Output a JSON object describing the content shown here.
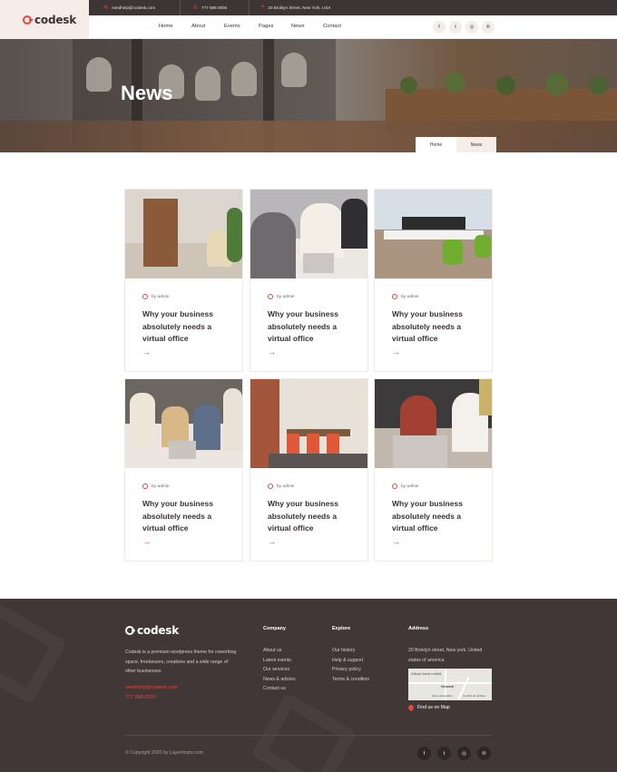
{
  "brand": {
    "name": "codesk"
  },
  "topbar": {
    "email": "needhelp@codesk.com",
    "phone": "777 888 0000",
    "address": "20 Broklyn Street, New York. USA"
  },
  "nav": {
    "items": [
      "Home",
      "About",
      "Events",
      "Pages",
      "News",
      "Contact"
    ]
  },
  "social_icons": [
    "facebook-icon",
    "twitter-icon",
    "instagram-icon",
    "pinterest-icon"
  ],
  "social_glyphs": [
    "f",
    "t",
    "◎",
    "℗"
  ],
  "hero": {
    "title": "News"
  },
  "breadcrumb": {
    "home": "Home",
    "current": "News"
  },
  "posts": [
    {
      "author": "by admin",
      "title": "Why your business absolutely needs a virtual office",
      "arrow": "→"
    },
    {
      "author": "by admin",
      "title": "Why your business absolutely needs a virtual office",
      "arrow": "→"
    },
    {
      "author": "by admin",
      "title": "Why your business absolutely needs a virtual office",
      "arrow": "→"
    },
    {
      "author": "by admin",
      "title": "Why your business absolutely needs a virtual office",
      "arrow": "→"
    },
    {
      "author": "by admin",
      "title": "Why your business absolutely needs a virtual office",
      "arrow": "→"
    },
    {
      "author": "by admin",
      "title": "Why your business absolutely needs a virtual office",
      "arrow": "→"
    }
  ],
  "footer": {
    "description": "Codesk is a premium wordpress theme for coworking space, freelancers, creatives and a wide range of other businesses.",
    "email": "needhelp@codesk.com",
    "phone": "777 888 0000",
    "company": {
      "heading": "Company",
      "links": [
        "About us",
        "Latest events",
        "Our services",
        "News & articles",
        "Contact us"
      ]
    },
    "explore": {
      "heading": "Explore",
      "links": [
        "Our history",
        "Help & support",
        "Privacy policy",
        "Terms & condition"
      ]
    },
    "address": {
      "heading": "Address",
      "text": "20 Broklyn street, New york. United states of america",
      "map_link": "Find us on Map",
      "map_labels": [
        "Afișați harta mărită",
        "Newark",
        "Date cartografice",
        "Condiții de utilizare"
      ]
    },
    "copyright": "© Copyright 2020 by Layerdrops.com"
  },
  "colors": {
    "accent": "#e4483a",
    "dark": "#3d3535",
    "light_pink": "#f6ece8"
  }
}
